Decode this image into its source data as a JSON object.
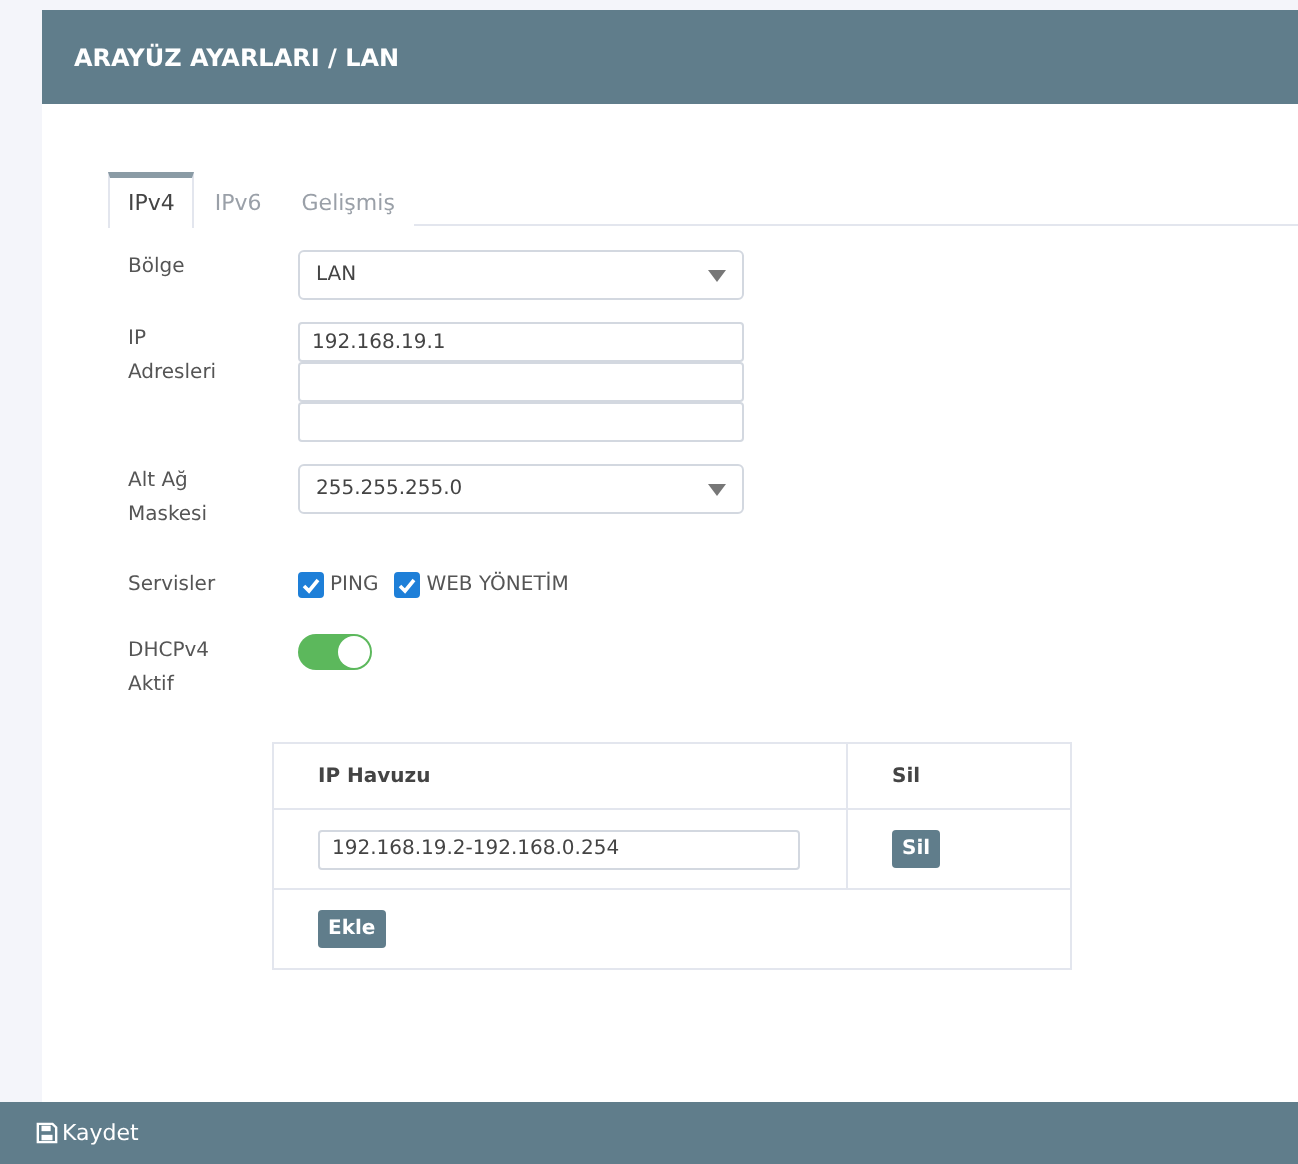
{
  "header": {
    "title": "ARAYÜZ AYARLARI / LAN"
  },
  "tabs": [
    {
      "label": "IPv4",
      "selected": true
    },
    {
      "label": "IPv6",
      "selected": false
    },
    {
      "label": "Gelişmiş",
      "selected": false
    }
  ],
  "region": {
    "label": "Bölge",
    "value": "LAN"
  },
  "ip_addresses": {
    "label_lines": [
      "IP",
      "Adresleri"
    ],
    "fields": [
      {
        "kind": "filled",
        "value": "192.168.19.1"
      },
      {
        "kind": "empty"
      },
      {
        "kind": "empty"
      }
    ]
  },
  "subnet": {
    "label_lines": [
      "Alt Ağ",
      "Maskesi"
    ],
    "value": "255.255.255.0"
  },
  "services": {
    "label": "Servisler",
    "items": [
      {
        "label": "PING",
        "checked": true
      },
      {
        "label": "WEB YÖNETİM",
        "checked": true
      }
    ]
  },
  "dhcp": {
    "label_lines": [
      "DHCPv4",
      "Aktif"
    ],
    "on": true
  },
  "pool_table": {
    "columns": [
      "IP Havuzu",
      "Sil"
    ],
    "rows": [
      {
        "value": "192.168.19.2-192.168.0.254",
        "button": "Sil"
      }
    ],
    "add_button": "Ekle"
  },
  "footer": {
    "save_button": "Kaydet"
  }
}
